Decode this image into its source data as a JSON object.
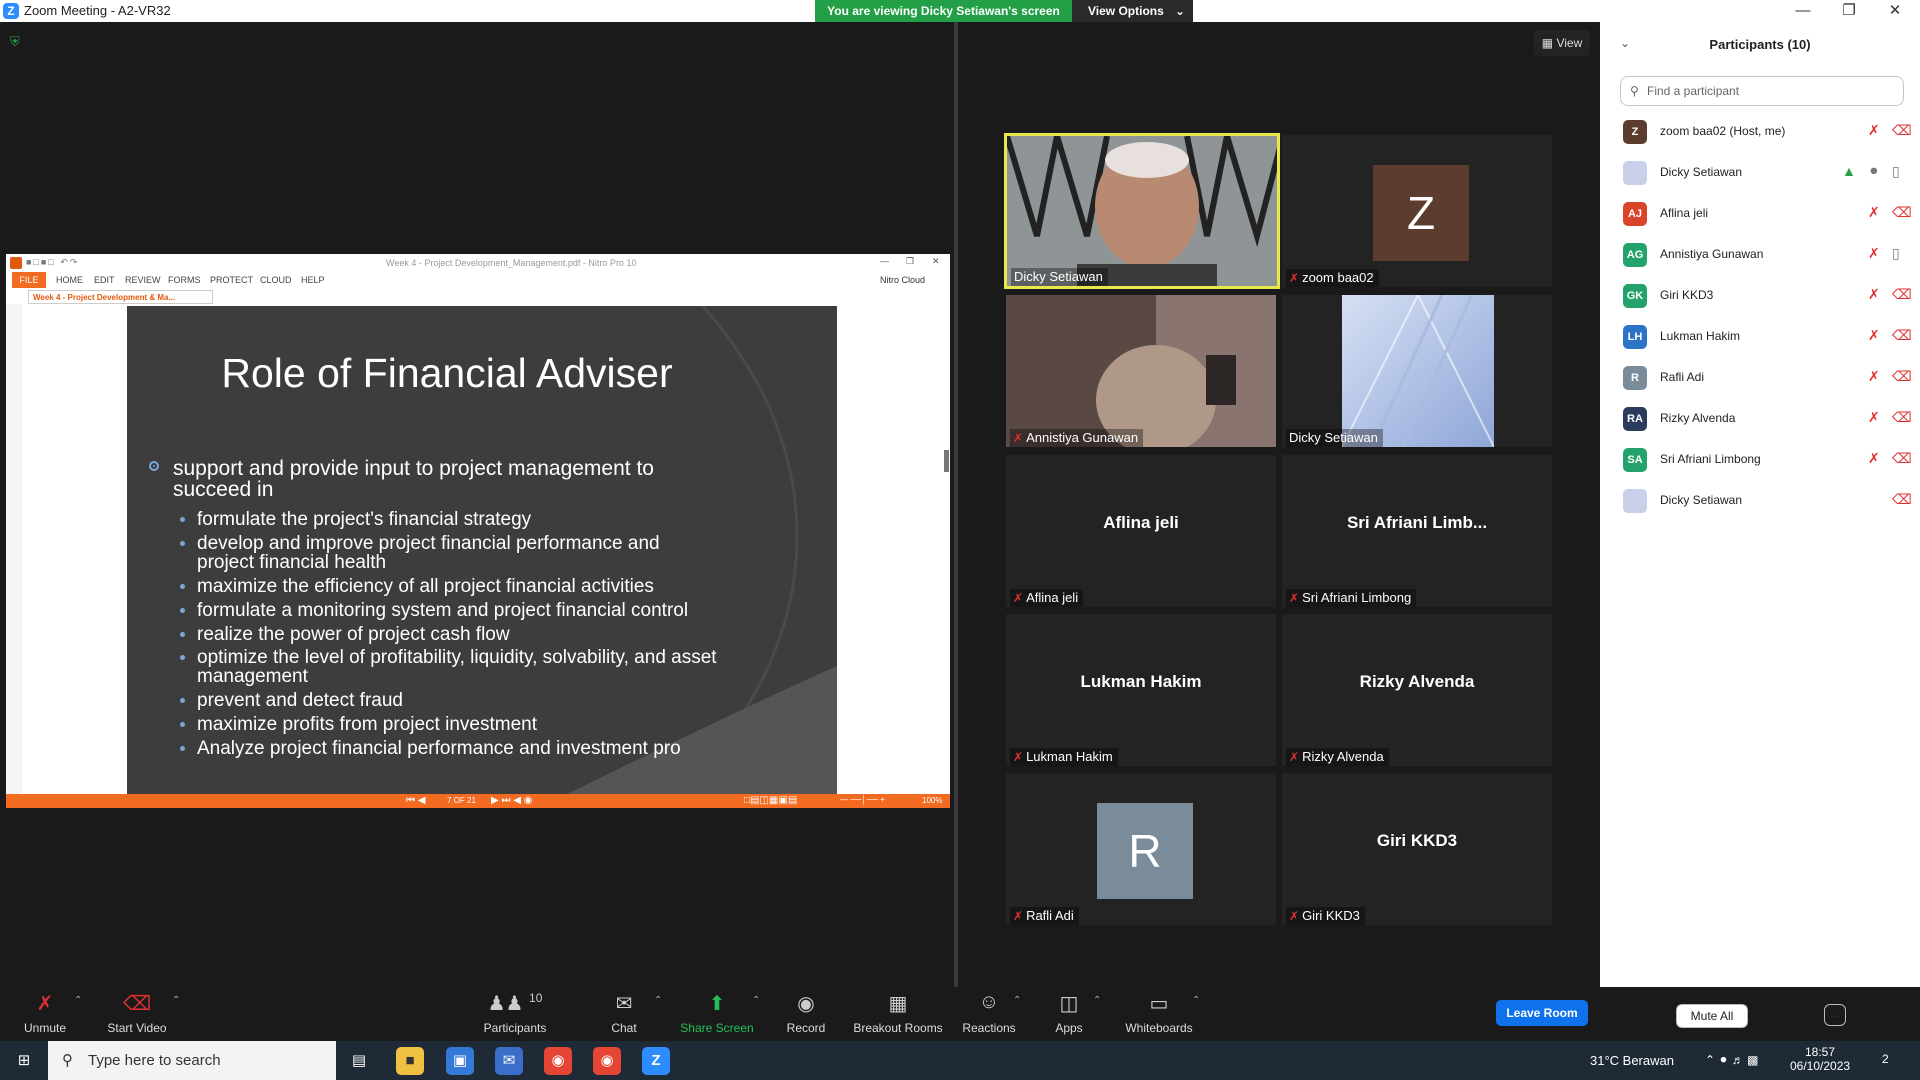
{
  "window": {
    "title": "Zoom Meeting - A2-VR32"
  },
  "banner": {
    "text": "You are viewing Dicky Setiawan's screen",
    "view_options": "View Options"
  },
  "view_button": "View",
  "nitro": {
    "window_title": "Week 4 - Project Development_Management.pdf - Nitro Pro 10",
    "menu": [
      "FILE",
      "HOME",
      "EDIT",
      "REVIEW",
      "FORMS",
      "PROTECT",
      "CLOUD",
      "HELP"
    ],
    "cloud_label": "Nitro Cloud",
    "tab_label": "Week 4 - Project Development & Ma...",
    "page_indicator": "7 OF 21",
    "zoom": "100%"
  },
  "slide": {
    "title": "Role of Financial Adviser",
    "main_bullet": "support and provide input to project management to succeed in",
    "sub_bullets": [
      "formulate the project's financial strategy",
      "develop and improve project financial performance and project financial health",
      "maximize the efficiency of all project financial activities",
      "formulate a monitoring system and project financial control",
      "realize the power of project cash flow",
      "optimize the level of profitability, liquidity, solvability, and asset management",
      "prevent and  detect fraud",
      "maximize profits from project investment",
      "Analyze project  financial performance and investment pro"
    ]
  },
  "tiles": [
    {
      "name": "Dicky Setiawan",
      "type": "video",
      "muted": false
    },
    {
      "name": "zoom baa02",
      "type": "avatar",
      "letter": "Z",
      "color": "#5b3c2f",
      "muted": true
    },
    {
      "name": "Annistiya Gunawan",
      "type": "video",
      "muted": true
    },
    {
      "name": "Dicky Setiawan",
      "type": "building",
      "muted": false
    },
    {
      "name": "Aflina jeli",
      "center": "Aflina jeli",
      "muted": true
    },
    {
      "name": "Sri Afriani Limbong",
      "center": "Sri  Afriani  Limb...",
      "muted": true
    },
    {
      "name": "Lukman Hakim",
      "center": "Lukman Hakim",
      "muted": true
    },
    {
      "name": "Rizky Alvenda",
      "center": "Rizky Alvenda",
      "muted": true
    },
    {
      "name": "Rafli Adi",
      "type": "avatar",
      "letter": "R",
      "color": "#7a8c9a",
      "muted": true
    },
    {
      "name": "Giri KKD3",
      "center": "Giri KKD3",
      "muted": true
    }
  ],
  "participants": {
    "title": "Participants (10)",
    "search_placeholder": "Find a participant",
    "list": [
      {
        "initials": "Z",
        "name": "zoom baa02 (Host, me)",
        "color": "#5b3c2f"
      },
      {
        "initials": "",
        "name": "Dicky Setiawan",
        "color": "#c8d0ea"
      },
      {
        "initials": "AJ",
        "name": "Aflina jeli",
        "color": "#d9442b"
      },
      {
        "initials": "AG",
        "name": "Annistiya Gunawan",
        "color": "#23a36b"
      },
      {
        "initials": "GK",
        "name": "Giri KKD3",
        "color": "#23a36b"
      },
      {
        "initials": "LH",
        "name": "Lukman Hakim",
        "color": "#2d74c9"
      },
      {
        "initials": "R",
        "name": "Rafli Adi",
        "color": "#7a8c9a"
      },
      {
        "initials": "RA",
        "name": "Rizky Alvenda",
        "color": "#2b3b5c"
      },
      {
        "initials": "SA",
        "name": "Sri Afriani Limbong",
        "color": "#23a36b"
      },
      {
        "initials": "",
        "name": "Dicky Setiawan",
        "color": "#c8d0ea"
      }
    ],
    "mute_all": "Mute All",
    "more": "..."
  },
  "toolbar": {
    "unmute": "Unmute",
    "start_video": "Start Video",
    "participants": "Participants",
    "participants_count": "10",
    "chat": "Chat",
    "share_screen": "Share Screen",
    "record": "Record",
    "breakout_rooms": "Breakout Rooms",
    "reactions": "Reactions",
    "apps": "Apps",
    "whiteboards": "Whiteboards",
    "leave_room": "Leave Room"
  },
  "taskbar": {
    "search_placeholder": "Type here to search",
    "weather": "31°C  Berawan",
    "time": "18:57",
    "date": "06/10/2023",
    "notification_count": "2"
  }
}
